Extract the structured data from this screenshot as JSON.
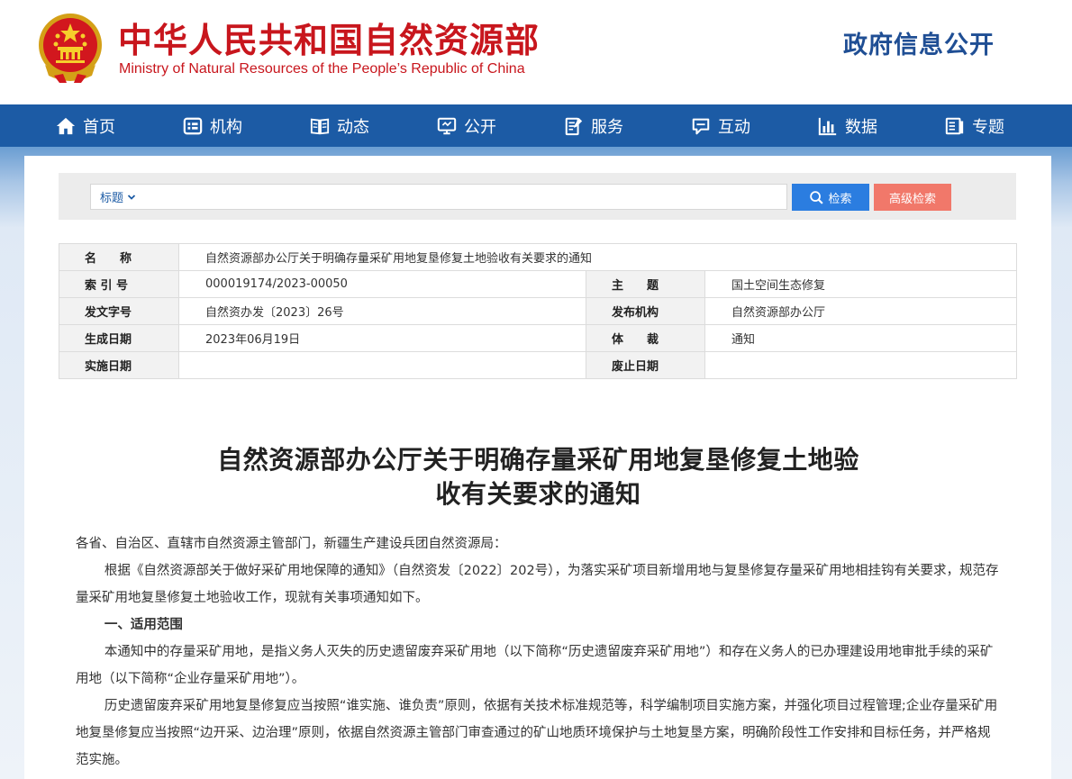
{
  "header": {
    "title_cn": "中华人民共和国自然资源部",
    "title_en": "Ministry of Natural Resources of the People’s Republic of China",
    "gov_info": "政府信息公开"
  },
  "nav": [
    {
      "label": "首页",
      "icon": "home-icon"
    },
    {
      "label": "机构",
      "icon": "org-icon"
    },
    {
      "label": "动态",
      "icon": "book-icon"
    },
    {
      "label": "公开",
      "icon": "monitor-icon"
    },
    {
      "label": "服务",
      "icon": "edit-doc-icon"
    },
    {
      "label": "互动",
      "icon": "chat-icon"
    },
    {
      "label": "数据",
      "icon": "bar-chart-icon"
    },
    {
      "label": "专题",
      "icon": "topic-icon"
    }
  ],
  "search": {
    "type_label": "标题",
    "value": "",
    "search_button": "检索",
    "advanced_button": "高级检索"
  },
  "info": {
    "name_label": "名　　称",
    "name_value": "自然资源部办公厅关于明确存量采矿用地复垦修复土地验收有关要求的通知",
    "index_label": "索 引 号",
    "index_value": "000019174/2023-00050",
    "topic_label": "主　　题",
    "topic_value": "国土空间生态修复",
    "docno_label": "发文字号",
    "docno_value": "自然资办发〔2023〕26号",
    "issuer_label": "发布机构",
    "issuer_value": "自然资源部办公厅",
    "created_label": "生成日期",
    "created_value": "2023年06月19日",
    "genre_label": "体　　裁",
    "genre_value": "通知",
    "effective_label": "实施日期",
    "effective_value": "",
    "expire_label": "废止日期",
    "expire_value": ""
  },
  "article": {
    "title_line1": "自然资源部办公厅关于明确存量采矿用地复垦修复土地验",
    "title_line2": "收有关要求的通知",
    "salutation": "各省、自治区、直辖市自然资源主管部门，新疆生产建设兵团自然资源局：",
    "para1": "根据《自然资源部关于做好采矿用地保障的通知》（自然资发〔2022〕202号），为落实采矿项目新增用地与复垦修复存量采矿用地相挂钩有关要求，规范存量采矿用地复垦修复土地验收工作，现就有关事项通知如下。",
    "section1": "一、适用范围",
    "para2": "本通知中的存量采矿用地，是指义务人灭失的历史遗留废弃采矿用地（以下简称“历史遗留废弃采矿用地”）和存在义务人的已办理建设用地审批手续的采矿用地（以下简称“企业存量采矿用地”）。",
    "para3": "历史遗留废弃采矿用地复垦修复应当按照“谁实施、谁负责”原则，依据有关技术标准规范等，科学编制项目实施方案，并强化项目过程管理;企业存量采矿用地复垦修复应当按照“边开采、边治理”原则，依据自然资源主管部门审查通过的矿山地质环境保护与土地复垦方案，明确阶段性工作安排和目标任务，并严格规范实施。"
  },
  "colors": {
    "brand_red": "#c8161d",
    "nav_blue": "#1c5ba5",
    "search_blue": "#2b7de0",
    "advanced_red": "#f1786a"
  }
}
